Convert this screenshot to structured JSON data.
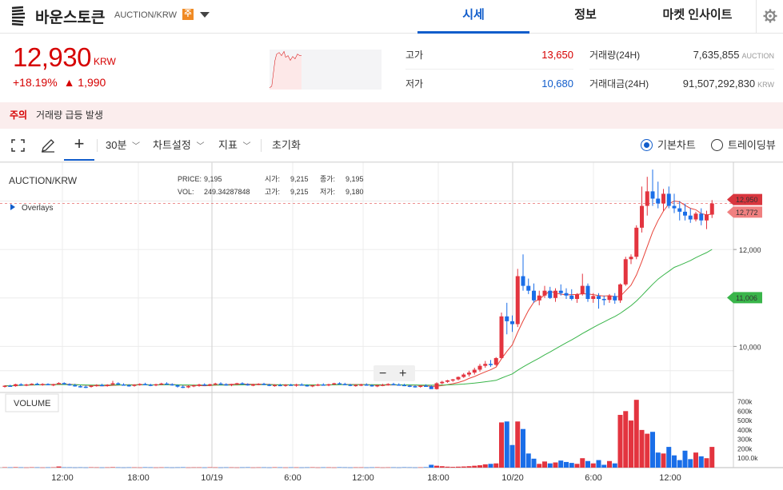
{
  "header": {
    "coin_name": "바운스토큰",
    "market": "AUCTION/KRW",
    "warning_badge": "주",
    "tabs": [
      {
        "label": "시세",
        "active": true
      },
      {
        "label": "정보",
        "active": false
      },
      {
        "label": "마켓 인사이트",
        "active": false
      }
    ],
    "icons": {
      "logo": "bounce-logo-icon",
      "dropdown": "caret-down-icon",
      "settings": "gear-icon"
    }
  },
  "summary": {
    "price": "12,930",
    "unit": "KRW",
    "change_rate": "+18.19%",
    "change_amount": "▲ 1,990",
    "high_label": "고가",
    "high_value": "13,650",
    "low_label": "저가",
    "low_value": "10,680",
    "volume_label": "거래량(24H)",
    "volume_value": "7,635,855",
    "volume_unit": "AUCTION",
    "amount_label": "거래대금(24H)",
    "amount_value": "91,507,292,830",
    "amount_unit": "KRW",
    "colors": {
      "up": "#d60000",
      "down": "#115dcb",
      "accent": "#115dcb"
    }
  },
  "alert": {
    "label": "주의",
    "text": "거래량 급등 발생"
  },
  "toolbar": {
    "interval": "30분",
    "chart_settings": "차트설정",
    "indicators": "지표",
    "reset": "초기화",
    "view_basic": "기본차트",
    "view_trading": "트레이딩뷰",
    "icons": [
      "fullscreen-icon",
      "pencil-icon",
      "crosshair-icon"
    ]
  },
  "chart_info": {
    "pair": "AUCTION/KRW",
    "overlays": "Overlays",
    "price_label": "PRICE:",
    "price_value": "9,195",
    "vol_label": "VOL:",
    "vol_value": "249.34287848",
    "open_label": "시가:",
    "open_value": "9,215",
    "high_label": "고가:",
    "high_value": "9,215",
    "close_label": "종가:",
    "close_value": "9,195",
    "low_label": "저가:",
    "low_value": "9,180",
    "volume_panel_label": "VOLUME",
    "zoom_out": "−",
    "zoom_in": "+"
  },
  "chart_data": {
    "type": "candlestick",
    "x_ticks": [
      "12:00",
      "18:00",
      "10/19",
      "6:00",
      "12:00",
      "18:00",
      "10/20",
      "6:00",
      "12:00"
    ],
    "y_ticks": [
      10000,
      11000,
      12000
    ],
    "y_tick_labels": [
      "10,000",
      "11,000",
      "12,000"
    ],
    "price_ylim": [
      9050,
      13800
    ],
    "price_markers": {
      "current": "12,950",
      "ma_short": "12,772",
      "ma_long": "11,006"
    },
    "volume_ticks": [
      "700k",
      "600k",
      "500k",
      "400k",
      "300k",
      "200k",
      "100.0k"
    ],
    "volume_ylim": [
      0,
      730000
    ],
    "ma_colors": {
      "short": "#e8443a",
      "long": "#39b54a"
    },
    "candles": [
      [
        9170,
        9200,
        9150,
        9190
      ],
      [
        9190,
        9210,
        9170,
        9180
      ],
      [
        9180,
        9230,
        9170,
        9220
      ],
      [
        9220,
        9240,
        9190,
        9200
      ],
      [
        9200,
        9230,
        9180,
        9215
      ],
      [
        9215,
        9240,
        9200,
        9230
      ],
      [
        9230,
        9250,
        9200,
        9210
      ],
      [
        9210,
        9240,
        9190,
        9225
      ],
      [
        9225,
        9240,
        9200,
        9205
      ],
      [
        9205,
        9230,
        9180,
        9220
      ],
      [
        9220,
        9260,
        9210,
        9245
      ],
      [
        9245,
        9260,
        9210,
        9220
      ],
      [
        9220,
        9240,
        9190,
        9200
      ],
      [
        9200,
        9230,
        9170,
        9180
      ],
      [
        9180,
        9200,
        9150,
        9170
      ],
      [
        9170,
        9190,
        9140,
        9165
      ],
      [
        9165,
        9200,
        9150,
        9190
      ],
      [
        9190,
        9220,
        9170,
        9205
      ],
      [
        9205,
        9230,
        9180,
        9195
      ],
      [
        9195,
        9220,
        9170,
        9210
      ],
      [
        9210,
        9290,
        9200,
        9240
      ],
      [
        9240,
        9260,
        9200,
        9215
      ],
      [
        9215,
        9240,
        9190,
        9200
      ],
      [
        9200,
        9220,
        9170,
        9190
      ],
      [
        9190,
        9220,
        9170,
        9210
      ],
      [
        9210,
        9240,
        9190,
        9225
      ],
      [
        9225,
        9250,
        9200,
        9210
      ],
      [
        9210,
        9230,
        9180,
        9195
      ],
      [
        9195,
        9230,
        9180,
        9220
      ],
      [
        9220,
        9250,
        9200,
        9235
      ],
      [
        9235,
        9260,
        9210,
        9220
      ],
      [
        9220,
        9240,
        9190,
        9200
      ],
      [
        9200,
        9220,
        9150,
        9170
      ],
      [
        9170,
        9200,
        9140,
        9160
      ],
      [
        9160,
        9190,
        9140,
        9180
      ],
      [
        9180,
        9210,
        9160,
        9200
      ],
      [
        9200,
        9230,
        9170,
        9215
      ],
      [
        9215,
        9240,
        9190,
        9200
      ],
      [
        9200,
        9230,
        9180,
        9220
      ],
      [
        9220,
        9250,
        9200,
        9235
      ],
      [
        9235,
        9260,
        9210,
        9220
      ],
      [
        9220,
        9240,
        9190,
        9200
      ],
      [
        9200,
        9230,
        9180,
        9225
      ],
      [
        9225,
        9250,
        9200,
        9240
      ],
      [
        9240,
        9260,
        9210,
        9220
      ],
      [
        9220,
        9240,
        9190,
        9205
      ],
      [
        9205,
        9230,
        9180,
        9215
      ],
      [
        9215,
        9240,
        9200,
        9230
      ],
      [
        9230,
        9250,
        9200,
        9210
      ],
      [
        9210,
        9230,
        9180,
        9195
      ],
      [
        9195,
        9220,
        9170,
        9205
      ],
      [
        9205,
        9230,
        9180,
        9190
      ],
      [
        9190,
        9220,
        9170,
        9210
      ],
      [
        9210,
        9230,
        9190,
        9200
      ],
      [
        9200,
        9230,
        9170,
        9215
      ],
      [
        9215,
        9240,
        9190,
        9200
      ],
      [
        9200,
        9220,
        9170,
        9185
      ],
      [
        9185,
        9210,
        9160,
        9200
      ],
      [
        9200,
        9230,
        9180,
        9215
      ],
      [
        9215,
        9240,
        9190,
        9205
      ],
      [
        9205,
        9230,
        9180,
        9220
      ],
      [
        9220,
        9250,
        9200,
        9240
      ],
      [
        9240,
        9260,
        9210,
        9225
      ],
      [
        9225,
        9250,
        9200,
        9210
      ],
      [
        9210,
        9230,
        9180,
        9195
      ],
      [
        9195,
        9220,
        9170,
        9205
      ],
      [
        9205,
        9230,
        9180,
        9215
      ],
      [
        9215,
        9240,
        9190,
        9200
      ],
      [
        9200,
        9220,
        9170,
        9180
      ],
      [
        9180,
        9210,
        9160,
        9200
      ],
      [
        9200,
        9230,
        9180,
        9210
      ],
      [
        9210,
        9240,
        9190,
        9225
      ],
      [
        9225,
        9250,
        9200,
        9215
      ],
      [
        9215,
        9240,
        9190,
        9205
      ],
      [
        9205,
        9230,
        9180,
        9190
      ],
      [
        9190,
        9210,
        9160,
        9180
      ],
      [
        9180,
        9200,
        9150,
        9170
      ],
      [
        9170,
        9200,
        9150,
        9190
      ],
      [
        9190,
        9220,
        9170,
        9175
      ],
      [
        9175,
        9200,
        9130,
        9120
      ],
      [
        9120,
        9260,
        9110,
        9240
      ],
      [
        9240,
        9290,
        9220,
        9270
      ],
      [
        9270,
        9310,
        9250,
        9300
      ],
      [
        9300,
        9330,
        9270,
        9320
      ],
      [
        9320,
        9380,
        9300,
        9370
      ],
      [
        9370,
        9450,
        9350,
        9420
      ],
      [
        9420,
        9500,
        9380,
        9460
      ],
      [
        9460,
        9560,
        9420,
        9520
      ],
      [
        9520,
        9640,
        9480,
        9600
      ],
      [
        9600,
        9700,
        9560,
        9640
      ],
      [
        9640,
        9720,
        9580,
        9620
      ],
      [
        9620,
        9780,
        9600,
        9760
      ],
      [
        9760,
        10700,
        9750,
        10620
      ],
      [
        10620,
        10900,
        10250,
        10520
      ],
      [
        10520,
        10640,
        10300,
        10460
      ],
      [
        10460,
        11600,
        10400,
        11450
      ],
      [
        11450,
        11900,
        11150,
        11250
      ],
      [
        11250,
        11400,
        11080,
        11150
      ],
      [
        11150,
        11300,
        10900,
        10950
      ],
      [
        10950,
        11150,
        10850,
        11050
      ],
      [
        11050,
        11250,
        11000,
        11150
      ],
      [
        11150,
        11230,
        10980,
        11000
      ],
      [
        11000,
        11200,
        10920,
        11150
      ],
      [
        11150,
        11280,
        11050,
        11100
      ],
      [
        11100,
        11200,
        10980,
        11050
      ],
      [
        11050,
        11180,
        10950,
        10980
      ],
      [
        10980,
        11100,
        10900,
        11080
      ],
      [
        11080,
        11500,
        11050,
        11250
      ],
      [
        11250,
        11300,
        10920,
        10980
      ],
      [
        10980,
        11100,
        10900,
        11040
      ],
      [
        11040,
        11100,
        10780,
        10980
      ],
      [
        10980,
        11050,
        10850,
        10960
      ],
      [
        10960,
        11080,
        10900,
        11040
      ],
      [
        11040,
        11100,
        10880,
        10950
      ],
      [
        10950,
        11300,
        10900,
        11280
      ],
      [
        11280,
        11850,
        11250,
        11800
      ],
      [
        11800,
        11900,
        11700,
        11850
      ],
      [
        11850,
        12500,
        11800,
        12450
      ],
      [
        12450,
        13300,
        12350,
        12900
      ],
      [
        12900,
        13500,
        12700,
        13200
      ],
      [
        13200,
        13650,
        12900,
        13050
      ],
      [
        13050,
        13400,
        12850,
        12950
      ],
      [
        12950,
        13250,
        12800,
        13150
      ],
      [
        13150,
        13300,
        12850,
        12900
      ],
      [
        12900,
        13150,
        12750,
        12850
      ],
      [
        12850,
        13000,
        12600,
        12780
      ],
      [
        12780,
        12950,
        12600,
        12700
      ],
      [
        12700,
        12850,
        12550,
        12620
      ],
      [
        12620,
        12780,
        12580,
        12740
      ],
      [
        12740,
        12850,
        12500,
        12600
      ],
      [
        12600,
        12800,
        12420,
        12720
      ],
      [
        12720,
        13020,
        12650,
        12950
      ]
    ],
    "volumes": [
      4000,
      3000,
      5000,
      3000,
      2000,
      4000,
      3000,
      2000,
      3000,
      4000,
      12000,
      3000,
      3000,
      2000,
      3000,
      2000,
      4000,
      3000,
      2000,
      3000,
      5000,
      3000,
      2000,
      3000,
      3000,
      2000,
      4000,
      3000,
      2000,
      3000,
      3000,
      2000,
      3000,
      4000,
      2000,
      3000,
      3000,
      2000,
      4000,
      3000,
      2000,
      3000,
      3000,
      2000,
      3000,
      4000,
      2000,
      3000,
      3000,
      2000,
      4000,
      3000,
      2000,
      3000,
      3000,
      2000,
      3000,
      4000,
      2000,
      3000,
      3000,
      2000,
      4000,
      3000,
      2000,
      3000,
      3000,
      2000,
      3000,
      4000,
      2000,
      3000,
      3000,
      2000,
      4000,
      3000,
      2000,
      3000,
      5000,
      30000,
      20000,
      15000,
      10000,
      8000,
      10000,
      12000,
      15000,
      20000,
      25000,
      35000,
      40000,
      45000,
      480000,
      490000,
      240000,
      490000,
      410000,
      150000,
      95000,
      40000,
      65000,
      45000,
      55000,
      75000,
      60000,
      50000,
      40000,
      100000,
      70000,
      45000,
      80000,
      30000,
      70000,
      45000,
      560000,
      600000,
      500000,
      720000,
      400000,
      360000,
      380000,
      160000,
      150000,
      220000,
      130000,
      80000,
      180000,
      90000,
      160000,
      120000,
      100000,
      220000
    ]
  }
}
